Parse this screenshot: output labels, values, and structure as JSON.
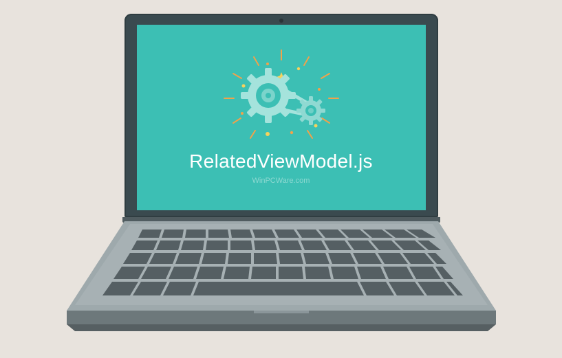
{
  "screen": {
    "filename": "RelatedViewModel.js",
    "watermark": "WinPCWare.com"
  },
  "colors": {
    "screen_bg": "#3cbfb4",
    "bezel": "#3a4a4f",
    "gear_light": "#a5e3dc",
    "gear_mid": "#6fd0c7",
    "accent_orange": "#f2a24a",
    "accent_yellow": "#f7d25c",
    "base_top": "#9ea9ac",
    "base_front": "#6d787b",
    "key": "#555f63"
  }
}
